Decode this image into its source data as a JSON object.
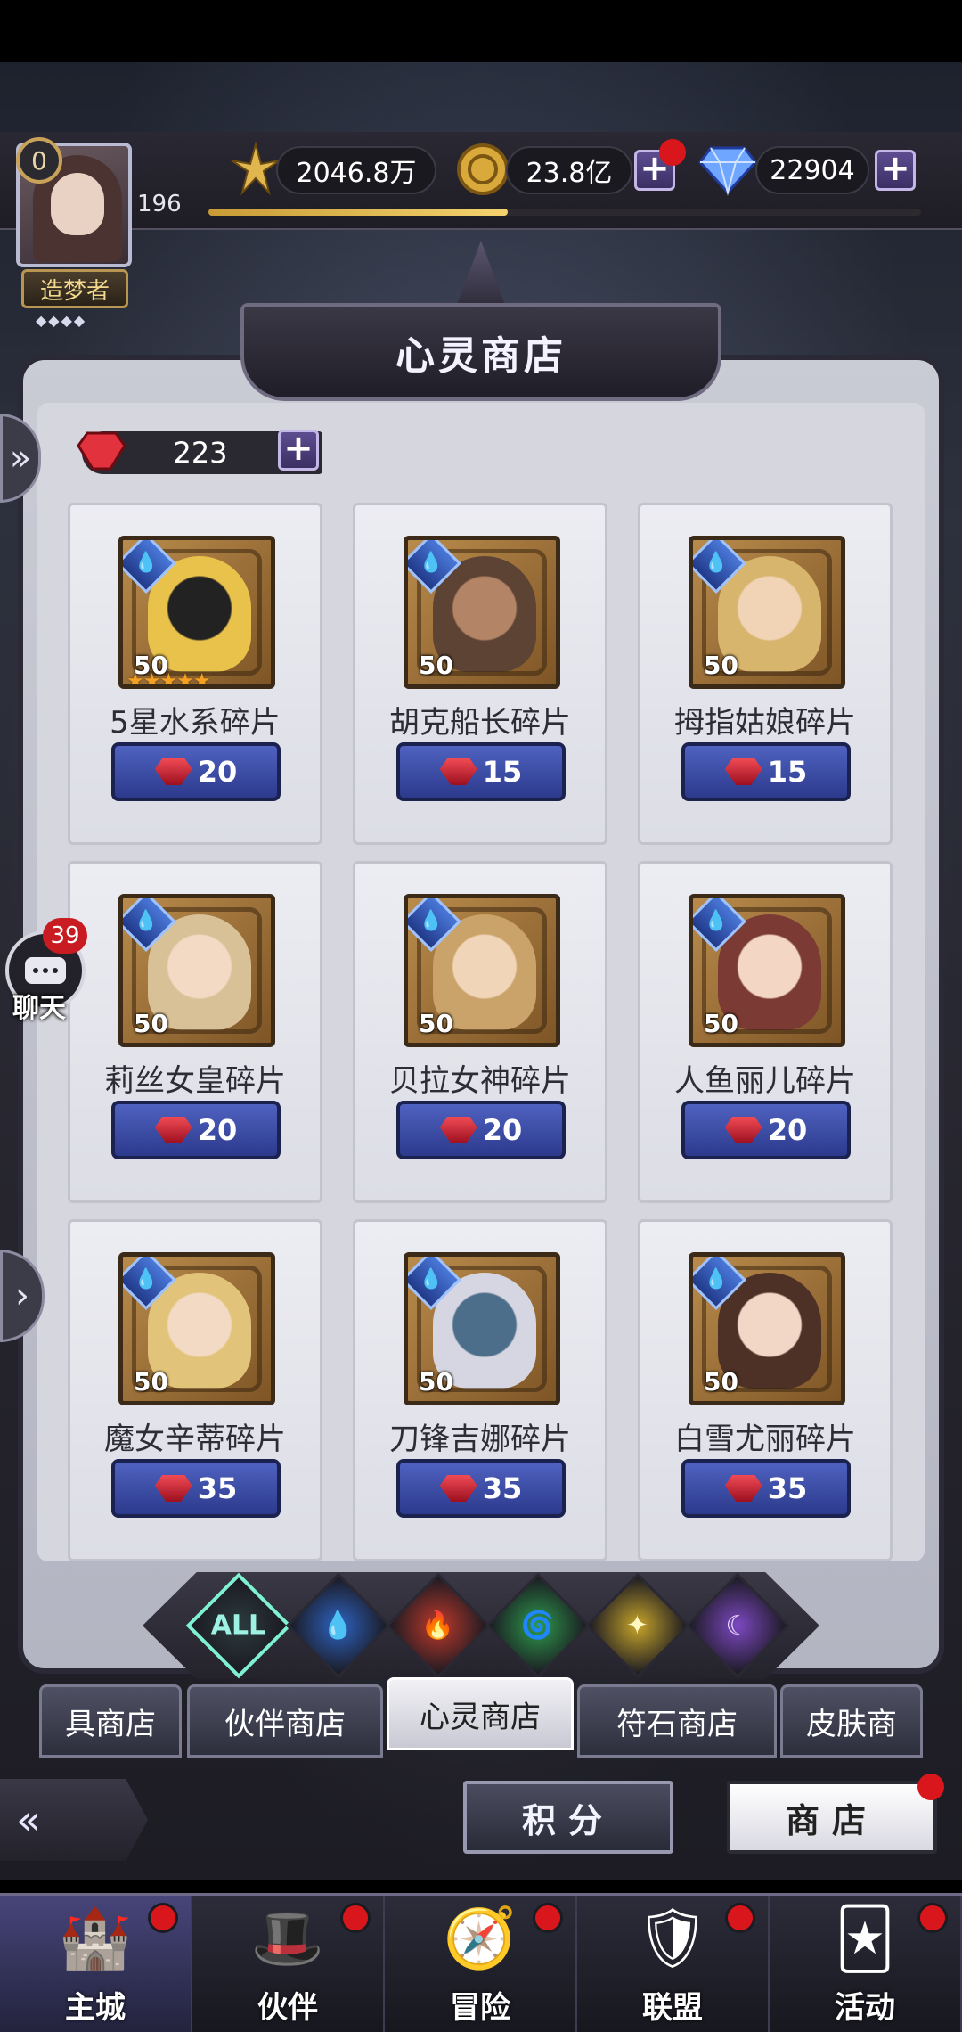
{
  "player": {
    "level_badge": "0",
    "level": "196",
    "rank": "造梦者",
    "rank_stars": "◆◆◆◆",
    "exp_fraction": 0.42
  },
  "resources": {
    "power": "2046.8万",
    "gold": "23.8亿",
    "diamonds": "22904",
    "plus": "+"
  },
  "shop": {
    "title": "心灵商店",
    "currency_amount": "223",
    "items": [
      {
        "name": "5星水系碎片",
        "count": "50",
        "price": "20",
        "stars": "★★★★★",
        "portrait_color": "#222",
        "bg": "#e8c24a"
      },
      {
        "name": "胡克船长碎片",
        "count": "50",
        "price": "15",
        "stars": "",
        "portrait_color": "#b38465",
        "bg": "#5d4334"
      },
      {
        "name": "拇指姑娘碎片",
        "count": "50",
        "price": "15",
        "stars": "",
        "portrait_color": "#f1d4b6",
        "bg": "#d8b56d"
      },
      {
        "name": "莉丝女皇碎片",
        "count": "50",
        "price": "20",
        "stars": "",
        "portrait_color": "#f2dac4",
        "bg": "#d8c197"
      },
      {
        "name": "贝拉女神碎片",
        "count": "50",
        "price": "20",
        "stars": "",
        "portrait_color": "#f0d5b8",
        "bg": "#c9a36a"
      },
      {
        "name": "人鱼丽儿碎片",
        "count": "50",
        "price": "20",
        "stars": "",
        "portrait_color": "#f3d6c4",
        "bg": "#7b3b34"
      },
      {
        "name": "魔女辛蒂碎片",
        "count": "50",
        "price": "35",
        "stars": "",
        "portrait_color": "#f3dac5",
        "bg": "#e1c47a"
      },
      {
        "name": "刀锋吉娜碎片",
        "count": "50",
        "price": "35",
        "stars": "",
        "portrait_color": "#4d6e8a",
        "bg": "#d6d6e2"
      },
      {
        "name": "白雪尤丽碎片",
        "count": "50",
        "price": "35",
        "stars": "",
        "portrait_color": "#f3d7c6",
        "bg": "#4d3126"
      }
    ]
  },
  "filters": [
    {
      "label": "ALL",
      "icon": "all-icon",
      "color": "#2b3b3e",
      "fg": "#9df2e3"
    },
    {
      "label": "💧",
      "icon": "water-icon",
      "color": "#2d63c2",
      "fg": "#cfe8ff"
    },
    {
      "label": "🔥",
      "icon": "fire-icon",
      "color": "#c0392b",
      "fg": "#ffd7a8"
    },
    {
      "label": "🌀",
      "icon": "wind-icon",
      "color": "#2d9b4c",
      "fg": "#d6ffcf"
    },
    {
      "label": "✦",
      "icon": "light-icon",
      "color": "#c7a52a",
      "fg": "#fff6c2"
    },
    {
      "label": "☾",
      "icon": "dark-icon",
      "color": "#7d48c2",
      "fg": "#f0e0ff"
    }
  ],
  "tabs": [
    "具商店",
    "伙伴商店",
    "心灵商店",
    "符石商店",
    "皮肤商"
  ],
  "actions": {
    "points": "积分",
    "store": "商店",
    "back": "«"
  },
  "chat": {
    "badge": "39",
    "label": "聊天"
  },
  "side": {
    "expand": "»",
    "next": "›"
  },
  "nav": [
    {
      "label": "主城",
      "icon": "castle-icon",
      "glyph": "🏰"
    },
    {
      "label": "伙伴",
      "icon": "wizard-hat-icon",
      "glyph": "🎩"
    },
    {
      "label": "冒险",
      "icon": "compass-icon",
      "glyph": "🧭"
    },
    {
      "label": "联盟",
      "icon": "shield-icon",
      "glyph": "🛡"
    },
    {
      "label": "活动",
      "icon": "cards-icon",
      "glyph": "🃏"
    }
  ]
}
